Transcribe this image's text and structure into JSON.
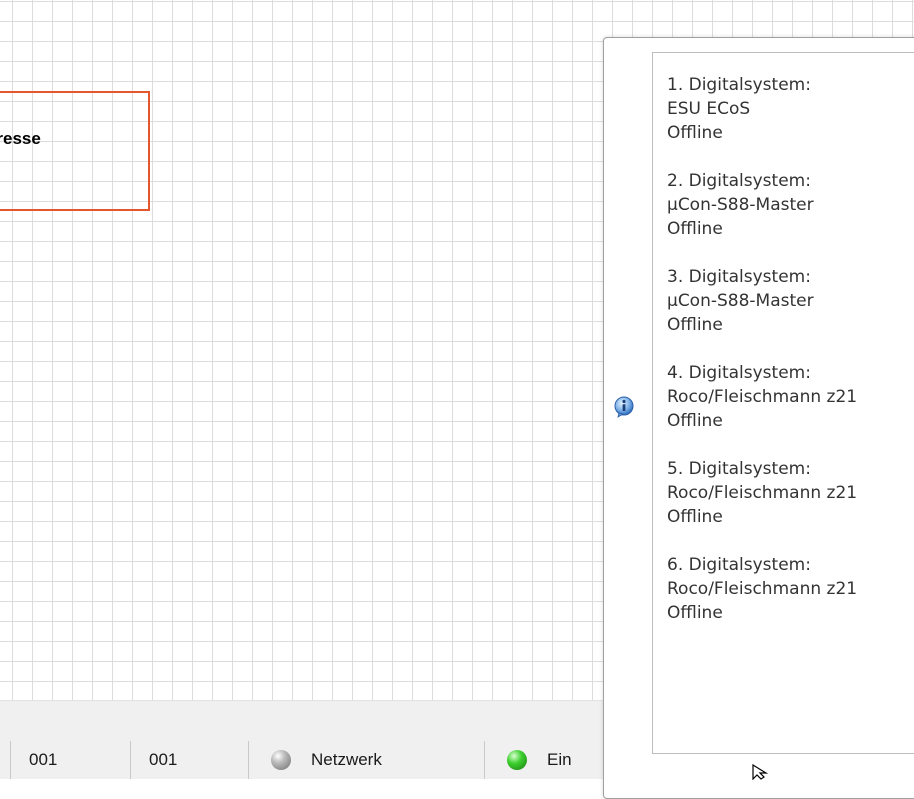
{
  "canvas": {
    "node_label": "dresse"
  },
  "statusbar": {
    "field1": "001",
    "field2": "001",
    "network_label": "Netzwerk",
    "power_label": "Ein"
  },
  "popup": {
    "icon": "info-icon",
    "entries": [
      {
        "title": "1. Digitalsystem:",
        "system": "ESU ECoS",
        "status": "Offline"
      },
      {
        "title": "2. Digitalsystem:",
        "system": "µCon-S88-Master",
        "status": "Offline"
      },
      {
        "title": "3. Digitalsystem:",
        "system": "µCon-S88-Master",
        "status": "Offline"
      },
      {
        "title": "4. Digitalsystem:",
        "system": "Roco/Fleischmann z21",
        "status": "Offline"
      },
      {
        "title": "5. Digitalsystem:",
        "system": "Roco/Fleischmann z21",
        "status": "Offline"
      },
      {
        "title": "6. Digitalsystem:",
        "system": "Roco/Fleischmann z21",
        "status": "Offline"
      }
    ]
  },
  "colors": {
    "node_border": "#e4572e",
    "network_led": "#8a8a8a",
    "power_led": "#2fbf22"
  }
}
